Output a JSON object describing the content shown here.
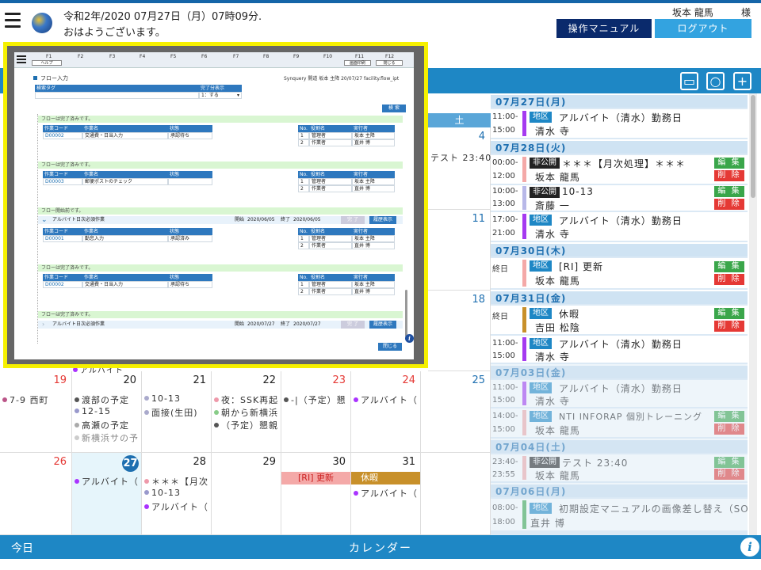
{
  "header": {
    "date": "令和2年/2020 07月27日（月）07時09分.",
    "greeting": "おはようございます。",
    "user": "坂本 龍馬",
    "honorific": "様",
    "manual_label": "操作マニュアル",
    "logout_label": "ログアウト"
  },
  "calendar": {
    "sat_label": "土",
    "cells": [
      {
        "num": "4",
        "events": [
          {
            "text": "テスト 23:40",
            "dot": ""
          }
        ]
      },
      {
        "num": "11",
        "events": []
      },
      {
        "num": "18",
        "events": []
      },
      {
        "num": "19",
        "events": [
          {
            "text": "7-9 西町",
            "dot": "#b58"
          }
        ]
      },
      {
        "num": "20",
        "events": [
          {
            "text": "渡部の予定",
            "dot": "#555"
          },
          {
            "text": "12-15",
            "dot": "#99c"
          },
          {
            "text": "高瀬の予定",
            "dot": "#aaa"
          },
          {
            "text": "新横浜サの予",
            "dot": "#ccc"
          }
        ]
      },
      {
        "num": "21",
        "events": [
          {
            "text": "10-13",
            "dot": "#aac"
          },
          {
            "text": "面接(生田)",
            "dot": "#aac"
          }
        ]
      },
      {
        "num": "22",
        "events": [
          {
            "text": "夜：SSK再起",
            "dot": "#e9a"
          },
          {
            "text": "朝から新横浜",
            "dot": "#8c8"
          },
          {
            "text": "（予定）懇親",
            "dot": "#555"
          }
        ]
      },
      {
        "num": "23",
        "events": [
          {
            "text": "-|（予定）懇",
            "dot": "#555"
          }
        ]
      },
      {
        "num": "24",
        "events": [
          {
            "text": "アルバイト（",
            "dot": "#a3f"
          }
        ]
      },
      {
        "num": "25",
        "events": []
      },
      {
        "num": "26",
        "events": []
      },
      {
        "num": "27",
        "events": [
          {
            "text": "アルバイト（",
            "dot": "#a3f"
          }
        ]
      },
      {
        "num": "28",
        "events": [
          {
            "text": "＊＊＊【月次",
            "dot": "#e9a"
          },
          {
            "text": "10-13",
            "dot": "#99c"
          },
          {
            "text": "アルバイト（",
            "dot": "#a3f"
          }
        ]
      },
      {
        "num": "29",
        "events": []
      },
      {
        "num": "30",
        "events": [
          {
            "text": "[RI] 更新",
            "dot": ""
          }
        ]
      },
      {
        "num": "31",
        "events": [
          {
            "text": "休暇",
            "dot": ""
          },
          {
            "text": "アルバイト（",
            "dot": "#a3f"
          }
        ]
      }
    ],
    "partial_event": "アルバイト"
  },
  "agenda": {
    "days": [
      {
        "label": "07月27日(月)",
        "items": [
          {
            "start": "11:00-",
            "end": "15:00",
            "tag": "地区",
            "title": "アルバイト（清水）勤務日",
            "person": "清水 寺",
            "edit": "",
            "del": ""
          }
        ]
      },
      {
        "label": "07月28日(火)",
        "items": [
          {
            "start": "00:00-",
            "end": "12:00",
            "tag": "非公開",
            "title": "＊＊＊【月次処理】＊＊＊",
            "person": "坂本 龍馬",
            "edit": "編 集",
            "del": "削 除"
          },
          {
            "start": "10:00-",
            "end": "13:00",
            "tag": "非公開",
            "title": "10-13",
            "person": "斎藤 一",
            "edit": "編 集",
            "del": "削 除"
          },
          {
            "start": "17:00-",
            "end": "21:00",
            "tag": "地区",
            "title": "アルバイト（清水）勤務日",
            "person": "清水 寺",
            "edit": "",
            "del": ""
          }
        ]
      },
      {
        "label": "07月30日(木)",
        "items": [
          {
            "start": "終日",
            "end": "",
            "tag": "地区",
            "title": "[RI] 更新",
            "person": "坂本 龍馬",
            "edit": "編 集",
            "del": "削 除"
          }
        ]
      },
      {
        "label": "07月31日(金)",
        "items": [
          {
            "start": "終日",
            "end": "",
            "tag": "地区",
            "title": "休暇",
            "person": "吉田 松陰",
            "edit": "編 集",
            "del": "削 除"
          },
          {
            "start": "11:00-",
            "end": "15:00",
            "tag": "地区",
            "title": "アルバイト（清水）勤務日",
            "person": "清水 寺",
            "edit": "",
            "del": ""
          }
        ]
      },
      {
        "label": "07月03日(金)",
        "items": [
          {
            "start": "11:00-",
            "end": "15:00",
            "tag": "地区",
            "title": "アルバイト（清水）勤務日",
            "person": "清水 寺",
            "edit": "",
            "del": ""
          },
          {
            "start": "14:00-",
            "end": "15:00",
            "tag": "地区",
            "title": "NTI INFORAP 個別トレーニング",
            "person": "坂本 龍馬",
            "edit": "編 集",
            "del": "削 除"
          }
        ]
      },
      {
        "label": "07月04日(土)",
        "items": [
          {
            "start": "23:40-",
            "end": "23:55",
            "tag": "非公開",
            "title": "テスト 23:40",
            "person": "坂本 龍馬",
            "edit": "編 集",
            "del": "削 除"
          }
        ]
      },
      {
        "label": "07月06日(月)",
        "items": [
          {
            "start": "08:00-",
            "end": "18:00",
            "tag": "地区",
            "title": "初期設定マニュアルの画像差し替え（SOB",
            "person": "直井 博",
            "edit": "",
            "del": ""
          }
        ]
      }
    ]
  },
  "footer": {
    "today": "今日",
    "calendar": "カレンダー",
    "info": "i"
  },
  "modal": {
    "fkeys": [
      "F1",
      "F2",
      "F3",
      "F4",
      "F5",
      "F6",
      "F7",
      "F8",
      "F9",
      "F10",
      "F11",
      "F12"
    ],
    "help_label": "ヘルプ",
    "print_label": "画面印刷",
    "close_small": "閉じる",
    "title": "フロー入力",
    "path": "Synquery 開道 坂本 主降 20/07/27 facility.flow_ipt",
    "search_tag_label": "検索タグ",
    "done_label": "完了分表示",
    "done_value": "1：する",
    "search_btn": "検 索",
    "flow_done": "フローは完了済みです。",
    "flow_start": "フロー開始前です。",
    "cols": [
      "作業コード",
      "作業名",
      "状態"
    ],
    "role_cols": [
      "No.",
      "役割名",
      "実行者"
    ],
    "blocks": [
      {
        "code": "D00002",
        "name": "交通費・日当入力",
        "state": "承認待ち",
        "roles": [
          {
            "no": "1",
            "role": "管理者",
            "user": "坂本 主降"
          },
          {
            "no": "2",
            "role": "作業者",
            "user": "直井 博"
          }
        ]
      },
      {
        "code": "D00003",
        "name": "郵便ポストのチェック",
        "state": "",
        "roles": [
          {
            "no": "1",
            "role": "管理者",
            "user": "坂本 主降"
          },
          {
            "no": "2",
            "role": "作業者",
            "user": "直井 博"
          }
        ]
      },
      {
        "code": "D00001",
        "name": "勤怠入力",
        "state": "承認済み",
        "roles": [
          {
            "no": "1",
            "role": "管理者",
            "user": "坂本 主降"
          },
          {
            "no": "2",
            "role": "作業者",
            "user": "直井 博"
          }
        ]
      },
      {
        "code": "D00002",
        "name": "交通費・日当入力",
        "state": "承認待ち",
        "roles": [
          {
            "no": "1",
            "role": "管理者",
            "user": "坂本 主降"
          },
          {
            "no": "2",
            "role": "作業者",
            "user": "直井 博"
          }
        ]
      }
    ],
    "group1": {
      "name": "アルバイト日次必須作業",
      "start_label": "開始",
      "start": "2020/06/05",
      "end_label": "終了",
      "end": "2020/06/05",
      "btn1": "完 了",
      "btn2": "履歴表示"
    },
    "group2": {
      "name": "アルバイト日次必須作業",
      "start_label": "開始",
      "start": "2020/07/27",
      "end_label": "終了",
      "end": "2020/07/27",
      "btn1": "完 了",
      "btn2": "履歴表示"
    },
    "close_label": "閉じる",
    "info": "i"
  }
}
